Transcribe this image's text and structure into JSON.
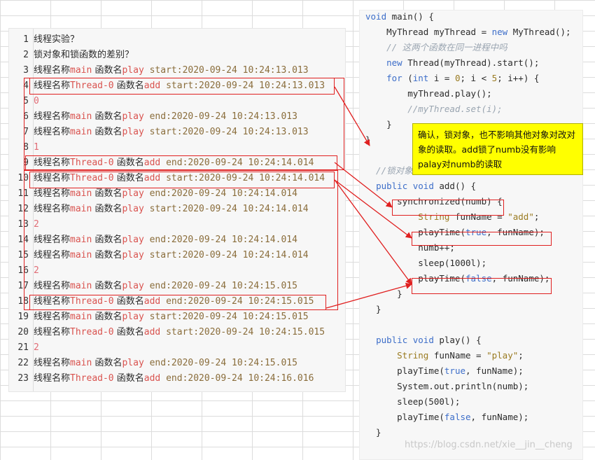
{
  "log_lines": [
    {
      "n": "1",
      "parts": [
        {
          "t": "线程实验？",
          "c": "zh"
        }
      ]
    },
    {
      "n": "2",
      "parts": [
        {
          "t": "锁对象和锁函数的差别？",
          "c": "zh"
        }
      ]
    },
    {
      "n": "3",
      "parts": [
        {
          "t": "线程名称",
          "c": "zh"
        },
        {
          "t": "main",
          "c": "red"
        },
        {
          "t": " 函数名",
          "c": "zh"
        },
        {
          "t": "play",
          "c": "red"
        },
        {
          "t": " start:2020-09-24 10:24:13.013",
          "c": "olive"
        }
      ]
    },
    {
      "n": "4",
      "parts": [
        {
          "t": "线程名称",
          "c": "zh"
        },
        {
          "t": "Thread-0",
          "c": "red"
        },
        {
          "t": " 函数名",
          "c": "zh"
        },
        {
          "t": "add",
          "c": "red"
        },
        {
          "t": " start:2020-09-24 10:24:13.013",
          "c": "olive"
        }
      ]
    },
    {
      "n": "5",
      "parts": [
        {
          "t": "0",
          "c": "num"
        }
      ]
    },
    {
      "n": "6",
      "parts": [
        {
          "t": "线程名称",
          "c": "zh"
        },
        {
          "t": "main",
          "c": "red"
        },
        {
          "t": " 函数名",
          "c": "zh"
        },
        {
          "t": "play",
          "c": "red"
        },
        {
          "t": " end:2020-09-24 10:24:13.013",
          "c": "olive"
        }
      ]
    },
    {
      "n": "7",
      "parts": [
        {
          "t": "线程名称",
          "c": "zh"
        },
        {
          "t": "main",
          "c": "red"
        },
        {
          "t": " 函数名",
          "c": "zh"
        },
        {
          "t": "play",
          "c": "red"
        },
        {
          "t": " start:2020-09-24 10:24:13.013",
          "c": "olive"
        }
      ]
    },
    {
      "n": "8",
      "parts": [
        {
          "t": "1",
          "c": "num"
        }
      ]
    },
    {
      "n": "9",
      "parts": [
        {
          "t": "线程名称",
          "c": "zh"
        },
        {
          "t": "Thread-0",
          "c": "red"
        },
        {
          "t": " 函数名",
          "c": "zh"
        },
        {
          "t": "add",
          "c": "red"
        },
        {
          "t": " end:2020-09-24 10:24:14.014",
          "c": "olive"
        }
      ]
    },
    {
      "n": "10",
      "parts": [
        {
          "t": "线程名称",
          "c": "zh"
        },
        {
          "t": "Thread-0",
          "c": "red"
        },
        {
          "t": " 函数名",
          "c": "zh"
        },
        {
          "t": "add",
          "c": "red"
        },
        {
          "t": " start:2020-09-24 10:24:14.014",
          "c": "olive"
        }
      ]
    },
    {
      "n": "11",
      "parts": [
        {
          "t": "线程名称",
          "c": "zh"
        },
        {
          "t": "main",
          "c": "red"
        },
        {
          "t": " 函数名",
          "c": "zh"
        },
        {
          "t": "play",
          "c": "red"
        },
        {
          "t": " end:2020-09-24 10:24:14.014",
          "c": "olive"
        }
      ]
    },
    {
      "n": "12",
      "parts": [
        {
          "t": "线程名称",
          "c": "zh"
        },
        {
          "t": "main",
          "c": "red"
        },
        {
          "t": " 函数名",
          "c": "zh"
        },
        {
          "t": "play",
          "c": "red"
        },
        {
          "t": " start:2020-09-24 10:24:14.014",
          "c": "olive"
        }
      ]
    },
    {
      "n": "13",
      "parts": [
        {
          "t": "2",
          "c": "num"
        }
      ]
    },
    {
      "n": "14",
      "parts": [
        {
          "t": "线程名称",
          "c": "zh"
        },
        {
          "t": "main",
          "c": "red"
        },
        {
          "t": " 函数名",
          "c": "zh"
        },
        {
          "t": "play",
          "c": "red"
        },
        {
          "t": " end:2020-09-24 10:24:14.014",
          "c": "olive"
        }
      ]
    },
    {
      "n": "15",
      "parts": [
        {
          "t": "线程名称",
          "c": "zh"
        },
        {
          "t": "main",
          "c": "red"
        },
        {
          "t": " 函数名",
          "c": "zh"
        },
        {
          "t": "play",
          "c": "red"
        },
        {
          "t": " start:2020-09-24 10:24:14.014",
          "c": "olive"
        }
      ]
    },
    {
      "n": "16",
      "parts": [
        {
          "t": "2",
          "c": "num"
        }
      ]
    },
    {
      "n": "17",
      "parts": [
        {
          "t": "线程名称",
          "c": "zh"
        },
        {
          "t": "main",
          "c": "red"
        },
        {
          "t": " 函数名",
          "c": "zh"
        },
        {
          "t": "play",
          "c": "red"
        },
        {
          "t": " end:2020-09-24 10:24:15.015",
          "c": "olive"
        }
      ]
    },
    {
      "n": "18",
      "parts": [
        {
          "t": "线程名称",
          "c": "zh"
        },
        {
          "t": "Thread-0",
          "c": "red"
        },
        {
          "t": " 函数名",
          "c": "zh"
        },
        {
          "t": "add",
          "c": "red"
        },
        {
          "t": " end:2020-09-24 10:24:15.015",
          "c": "olive"
        }
      ]
    },
    {
      "n": "19",
      "parts": [
        {
          "t": "线程名称",
          "c": "zh"
        },
        {
          "t": "main",
          "c": "red"
        },
        {
          "t": " 函数名",
          "c": "zh"
        },
        {
          "t": "play",
          "c": "red"
        },
        {
          "t": " start:2020-09-24 10:24:15.015",
          "c": "olive"
        }
      ]
    },
    {
      "n": "20",
      "parts": [
        {
          "t": "线程名称",
          "c": "zh"
        },
        {
          "t": "Thread-0",
          "c": "red"
        },
        {
          "t": " 函数名",
          "c": "zh"
        },
        {
          "t": "add",
          "c": "red"
        },
        {
          "t": " start:2020-09-24 10:24:15.015",
          "c": "olive"
        }
      ]
    },
    {
      "n": "21",
      "parts": [
        {
          "t": "2",
          "c": "num"
        }
      ]
    },
    {
      "n": "22",
      "parts": [
        {
          "t": "线程名称",
          "c": "zh"
        },
        {
          "t": "main",
          "c": "red"
        },
        {
          "t": " 函数名",
          "c": "zh"
        },
        {
          "t": "play",
          "c": "red"
        },
        {
          "t": " end:2020-09-24 10:24:15.015",
          "c": "olive"
        }
      ]
    },
    {
      "n": "23",
      "parts": [
        {
          "t": "线程名称",
          "c": "zh"
        },
        {
          "t": "Thread-0",
          "c": "red"
        },
        {
          "t": " 函数名",
          "c": "zh"
        },
        {
          "t": "add",
          "c": "red"
        },
        {
          "t": " end:2020-09-24 10:24:16.016",
          "c": "olive"
        }
      ]
    }
  ],
  "code_lines": [
    [
      {
        "t": "void",
        "c": "kw"
      },
      {
        "t": " main() {",
        "c": "plain"
      }
    ],
    [
      {
        "t": "    MyThread myThread = ",
        "c": "plain"
      },
      {
        "t": "new",
        "c": "kw"
      },
      {
        "t": " MyThread();",
        "c": "plain"
      }
    ],
    [
      {
        "t": "    // 这两个函数在同一进程中吗",
        "c": "cm"
      }
    ],
    [
      {
        "t": "    ",
        "c": "plain"
      },
      {
        "t": "new",
        "c": "kw"
      },
      {
        "t": " Thread(myThread).start();",
        "c": "plain"
      }
    ],
    [
      {
        "t": "    ",
        "c": "plain"
      },
      {
        "t": "for",
        "c": "kw"
      },
      {
        "t": " (",
        "c": "plain"
      },
      {
        "t": "int",
        "c": "kw"
      },
      {
        "t": " i = ",
        "c": "plain"
      },
      {
        "t": "0",
        "c": "str"
      },
      {
        "t": "; i < ",
        "c": "plain"
      },
      {
        "t": "5",
        "c": "str"
      },
      {
        "t": "; i++) {",
        "c": "plain"
      }
    ],
    [
      {
        "t": "        myThread.play();",
        "c": "plain"
      }
    ],
    [
      {
        "t": "        //myThread.set(i);",
        "c": "cm"
      }
    ],
    [
      {
        "t": "    }",
        "c": "plain"
      }
    ],
    [
      {
        "t": "}",
        "c": "plain"
      }
    ],
    [],
    [
      {
        "t": "  //锁对象",
        "c": "cm"
      }
    ],
    [
      {
        "t": "  ",
        "c": "plain"
      },
      {
        "t": "public",
        "c": "kw"
      },
      {
        "t": " ",
        "c": "plain"
      },
      {
        "t": "void",
        "c": "kw"
      },
      {
        "t": " add() {",
        "c": "plain"
      }
    ],
    [
      {
        "t": "      synchronized(numb) {",
        "c": "plain"
      }
    ],
    [
      {
        "t": "          ",
        "c": "plain"
      },
      {
        "t": "String",
        "c": "str"
      },
      {
        "t": " funName = ",
        "c": "plain"
      },
      {
        "t": "\"add\"",
        "c": "str"
      },
      {
        "t": ";",
        "c": "plain"
      }
    ],
    [
      {
        "t": "          playTime(",
        "c": "plain"
      },
      {
        "t": "true",
        "c": "kw"
      },
      {
        "t": ", funName);",
        "c": "plain"
      }
    ],
    [
      {
        "t": "          numb++;",
        "c": "plain"
      }
    ],
    [
      {
        "t": "          sleep(1000l);",
        "c": "plain"
      }
    ],
    [
      {
        "t": "          playTime(",
        "c": "plain"
      },
      {
        "t": "false",
        "c": "kw"
      },
      {
        "t": ", funName);",
        "c": "plain"
      }
    ],
    [
      {
        "t": "      }",
        "c": "plain"
      }
    ],
    [
      {
        "t": "  }",
        "c": "plain"
      }
    ],
    [],
    [
      {
        "t": "  ",
        "c": "plain"
      },
      {
        "t": "public",
        "c": "kw"
      },
      {
        "t": " ",
        "c": "plain"
      },
      {
        "t": "void",
        "c": "kw"
      },
      {
        "t": " play() {",
        "c": "plain"
      }
    ],
    [
      {
        "t": "      ",
        "c": "plain"
      },
      {
        "t": "String",
        "c": "str"
      },
      {
        "t": " funName = ",
        "c": "plain"
      },
      {
        "t": "\"play\"",
        "c": "str"
      },
      {
        "t": ";",
        "c": "plain"
      }
    ],
    [
      {
        "t": "      playTime(",
        "c": "plain"
      },
      {
        "t": "true",
        "c": "kw"
      },
      {
        "t": ", funName);",
        "c": "plain"
      }
    ],
    [
      {
        "t": "      System.out.println(numb);",
        "c": "plain"
      }
    ],
    [
      {
        "t": "      sleep(500l);",
        "c": "plain"
      }
    ],
    [
      {
        "t": "      playTime(",
        "c": "plain"
      },
      {
        "t": "false",
        "c": "kw"
      },
      {
        "t": ", funName);",
        "c": "plain"
      }
    ],
    [
      {
        "t": "  }",
        "c": "plain"
      }
    ]
  ],
  "note_text": "确认，锁对象，也不影响其他对象对改对象的读取。add锁了numb没有影响palay对numb的读取",
  "watermark": "https://blog.csdn.net/xie__jin__cheng",
  "colors": {
    "annotation_red": "#e02020",
    "note_bg": "#ffff00"
  }
}
